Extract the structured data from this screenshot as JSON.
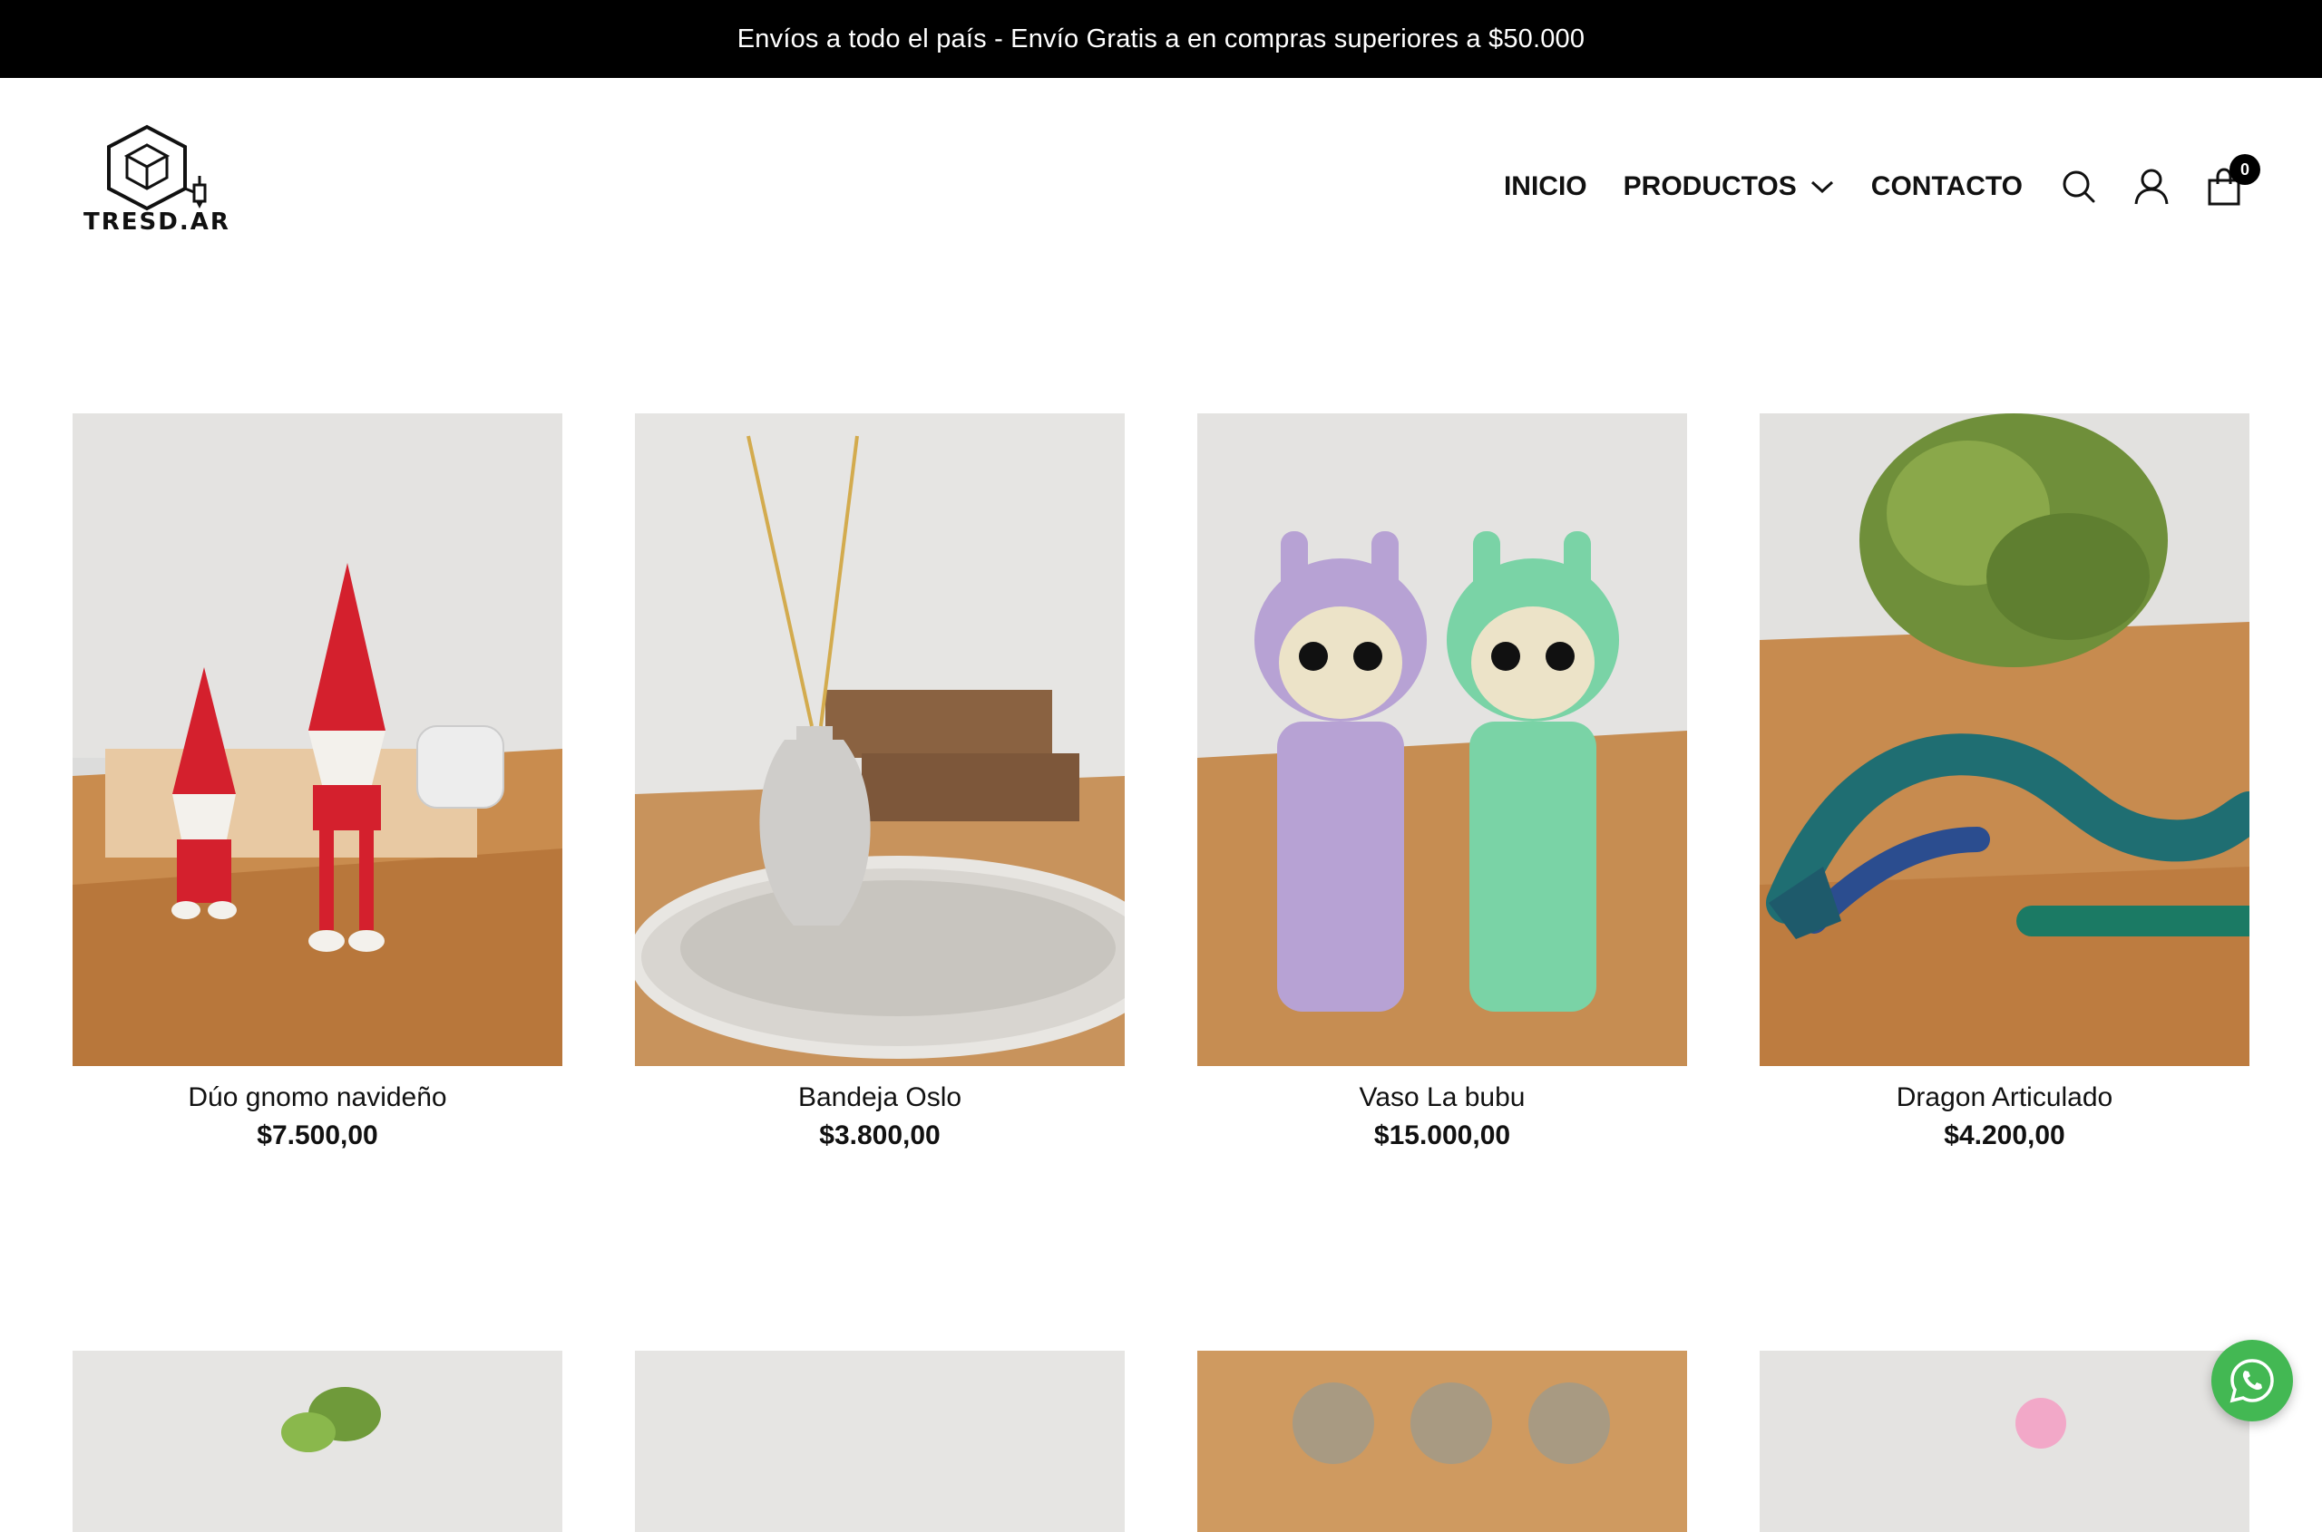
{
  "announcement": {
    "text": "Envíos a todo el país - Envío Gratis a en compras superiores a $50.000"
  },
  "header": {
    "logo_text": "TRESD.AR",
    "nav": [
      {
        "label": "INICIO"
      },
      {
        "label": "PRODUCTOS",
        "has_dropdown": true
      },
      {
        "label": "CONTACTO"
      }
    ],
    "icons": [
      "search-icon",
      "user-icon",
      "shopping-bag-icon"
    ],
    "cart_count": "0"
  },
  "products": [
    {
      "name": "Dúo gnomo navideño",
      "price": "$7.500,00"
    },
    {
      "name": "Bandeja Oslo",
      "price": "$3.800,00"
    },
    {
      "name": "Vaso La bubu",
      "price": "$15.000,00"
    },
    {
      "name": "Dragon Articulado",
      "price": "$4.200,00"
    }
  ],
  "colors": {
    "announcement_bg": "#000000",
    "whatsapp": "#43b853",
    "text": "#111111"
  },
  "floating": {
    "icon": "whatsapp-icon"
  }
}
